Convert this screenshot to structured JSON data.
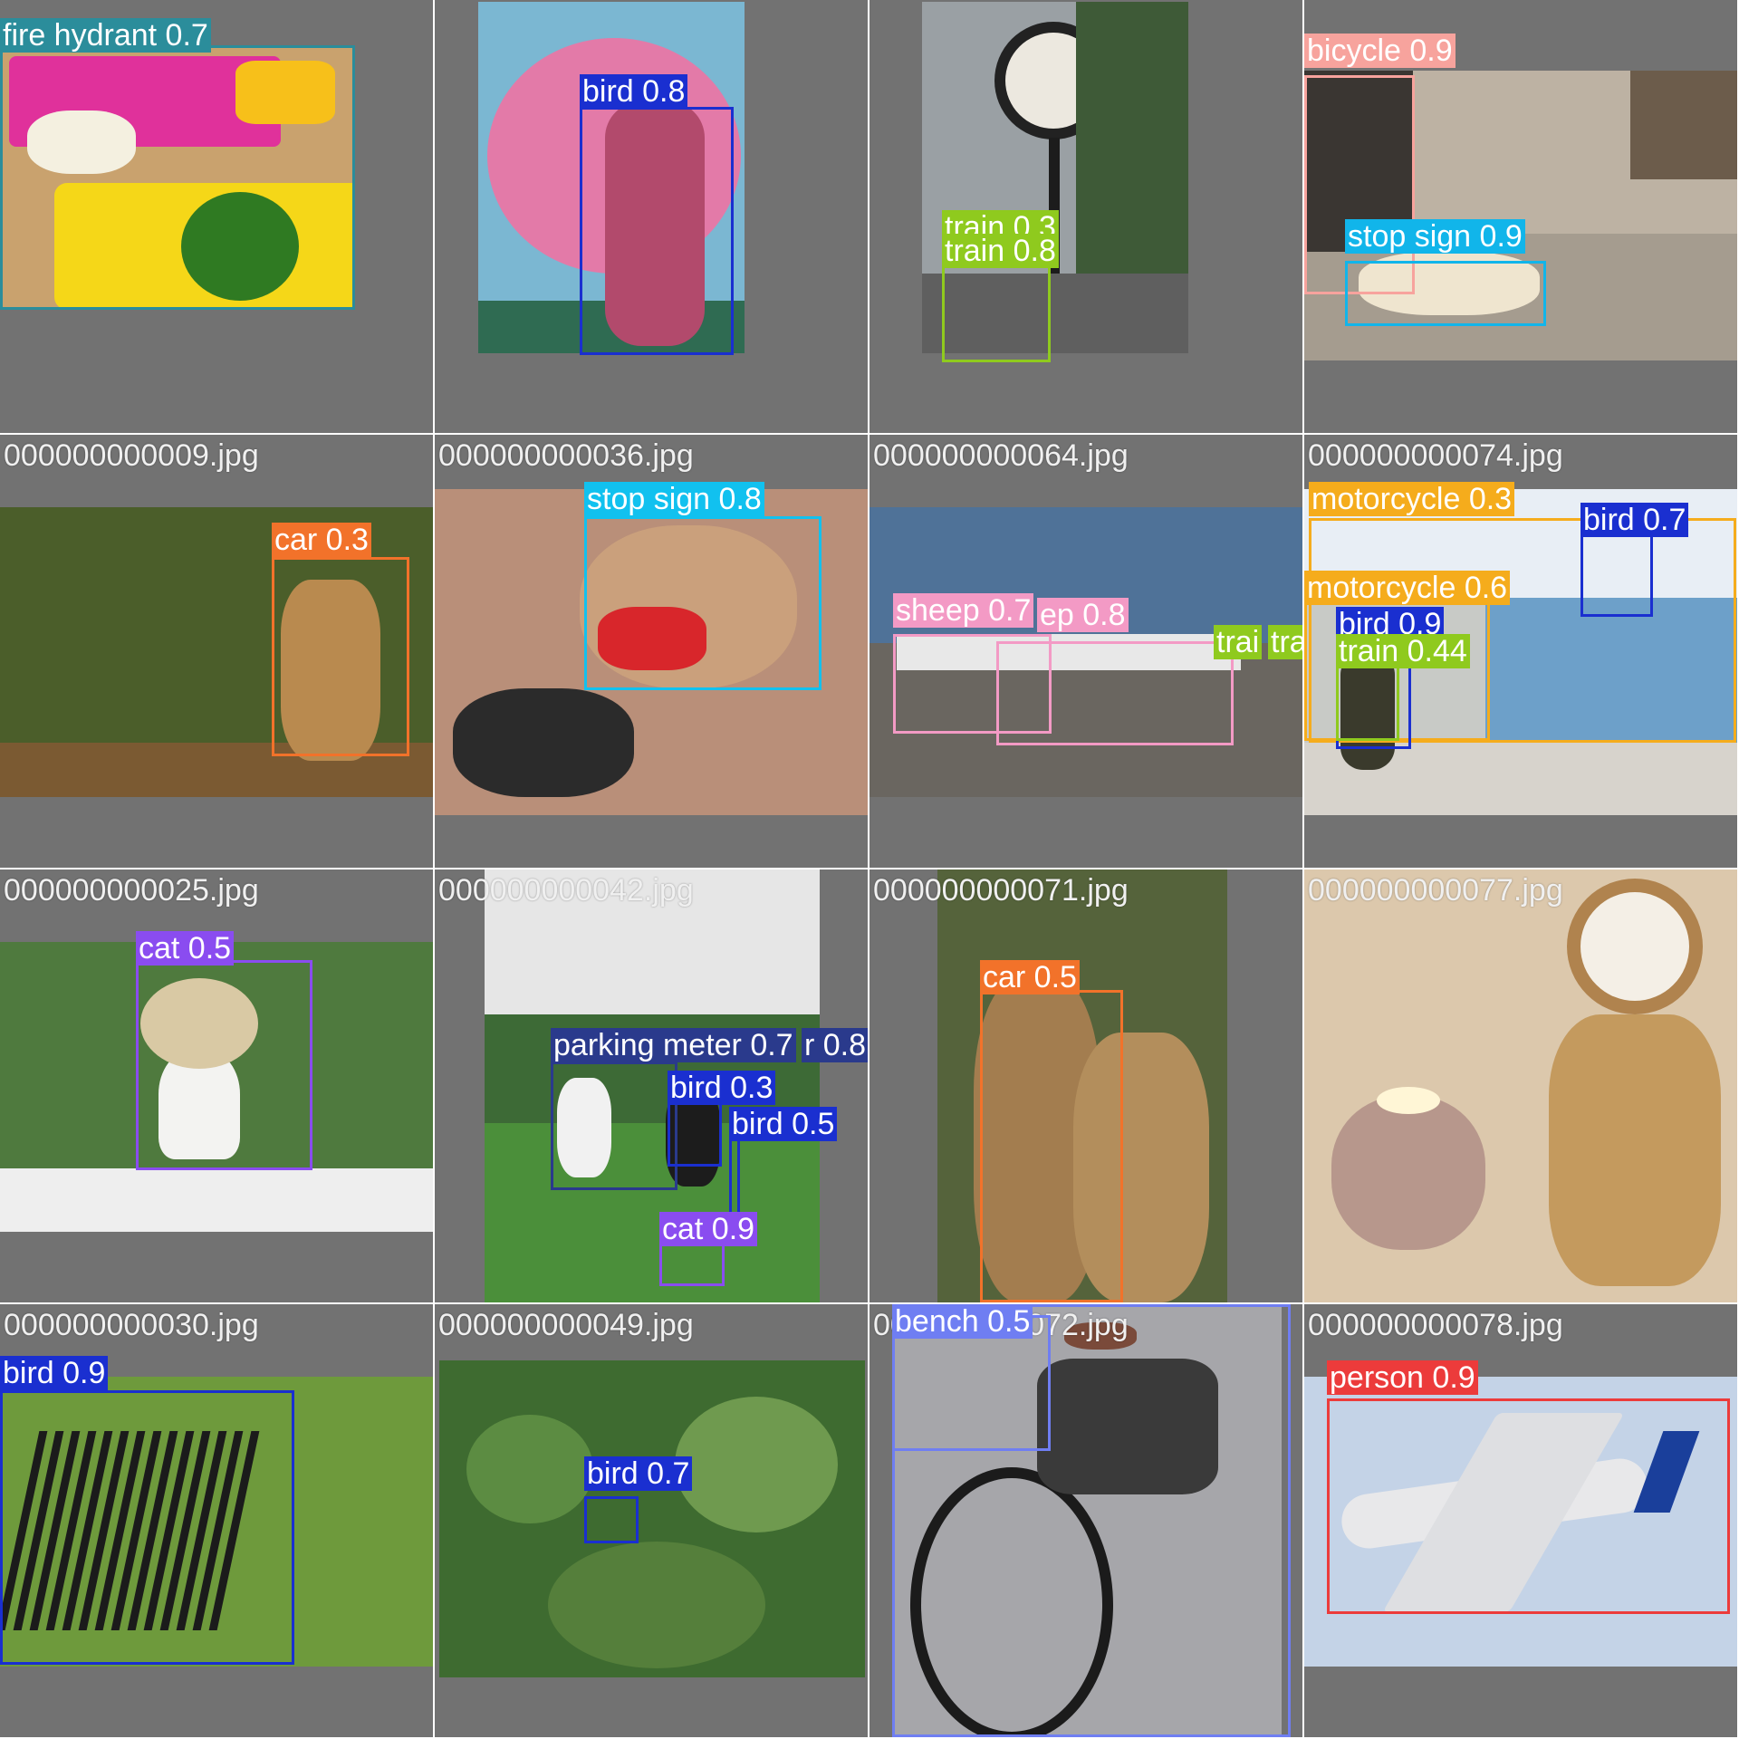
{
  "tiles": [
    {
      "filename": "",
      "detections": [
        {
          "label": "fire hydrant 0.7",
          "color": "#2b8d9b"
        }
      ]
    },
    {
      "filename": "",
      "detections": [
        {
          "label": "bird 0.8",
          "color": "#1a2fd0"
        }
      ]
    },
    {
      "filename": "",
      "detections": [
        {
          "label": "train 0.3",
          "color": "#8fca1e"
        },
        {
          "label": "train 0.8",
          "color": "#8fca1e"
        }
      ]
    },
    {
      "filename": "",
      "detections": [
        {
          "label": "bicycle 0.9",
          "color": "#f7a39d"
        },
        {
          "label": "stop sign 0.9",
          "color": "#11b5ea"
        }
      ]
    },
    {
      "filename": "000000000009.jpg",
      "detections": [
        {
          "label": "car 0.3",
          "color": "#f2722a"
        }
      ]
    },
    {
      "filename": "000000000036.jpg",
      "detections": [
        {
          "label": "stop sign 0.8",
          "color": "#11c1ef"
        }
      ]
    },
    {
      "filename": "000000000064.jpg",
      "detections": [
        {
          "label": "sheep 0.7",
          "color": "#f39ac5"
        },
        {
          "label": "ep 0.8",
          "color": "#f39ac5"
        },
        {
          "label": "trai",
          "color": "#8fca1e"
        },
        {
          "label": "tra",
          "color": "#8fca1e"
        }
      ]
    },
    {
      "filename": "000000000074.jpg",
      "detections": [
        {
          "label": "motorcycle 0.3",
          "color": "#f5ac1c"
        },
        {
          "label": "bird 0.7",
          "color": "#1a2fd0"
        },
        {
          "label": "motorcycle 0.6",
          "color": "#f5ac1c"
        },
        {
          "label": "bird 0.9",
          "color": "#1a2fd0"
        },
        {
          "label": "train 0.44",
          "color": "#8fca1e"
        }
      ]
    },
    {
      "filename": "000000000025.jpg",
      "detections": [
        {
          "label": "cat 0.5",
          "color": "#8a4cf0"
        }
      ]
    },
    {
      "filename": "000000000042.jpg",
      "detections": [
        {
          "label": "parking meter 0.7",
          "color": "#2a3a8c"
        },
        {
          "label": "r 0.8",
          "color": "#2a3a8c"
        },
        {
          "label": "bird 0.3",
          "color": "#1a2fd0"
        },
        {
          "label": "bird 0.5",
          "color": "#1a2fd0"
        },
        {
          "label": "cat 0.9",
          "color": "#8a4cf0"
        }
      ]
    },
    {
      "filename": "000000000071.jpg",
      "detections": [
        {
          "label": "car 0.5",
          "color": "#f2722a"
        }
      ]
    },
    {
      "filename": "000000000077.jpg",
      "detections": []
    },
    {
      "filename": "000000000030.jpg",
      "detections": [
        {
          "label": "bird 0.9",
          "color": "#1a2fd0"
        }
      ]
    },
    {
      "filename": "000000000049.jpg",
      "detections": [
        {
          "label": "bird 0.7",
          "color": "#1a2fd0"
        }
      ]
    },
    {
      "filename": "000000000072.jpg",
      "detections": [
        {
          "label": "bench 0.5",
          "color": "#6f7ef2"
        },
        {
          "label": "bench 0.5",
          "color": "#6f7ef2"
        }
      ]
    },
    {
      "filename": "000000000078.jpg",
      "detections": [
        {
          "label": "person 0.9",
          "color": "#ec3b3b"
        }
      ]
    }
  ]
}
